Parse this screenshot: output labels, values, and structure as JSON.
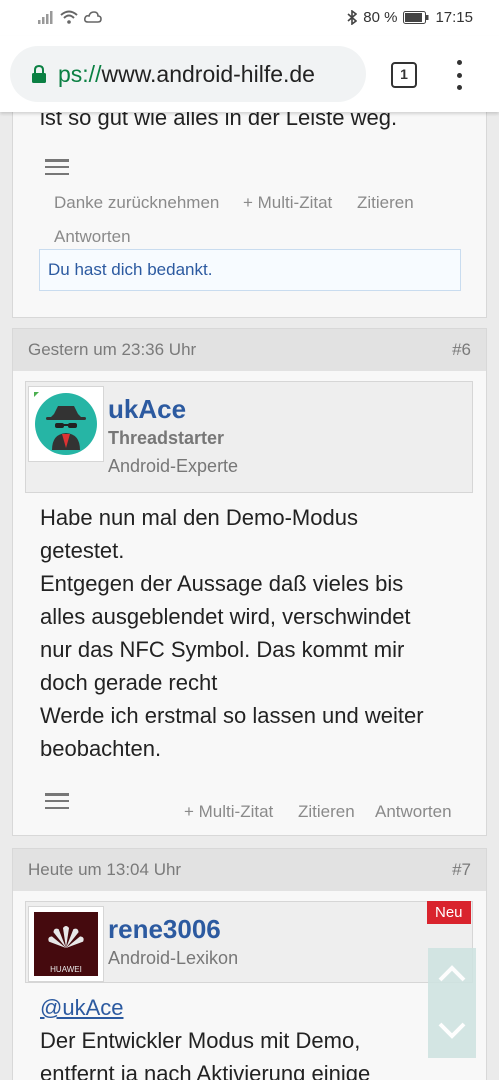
{
  "status_bar": {
    "battery_percent": "80 %",
    "time": "17:15"
  },
  "browser": {
    "url_scheme": "ps://",
    "url_host": "www.android-hilfe.de",
    "tab_count": "1"
  },
  "post5": {
    "partial_text": "ist so gut wie alles in der Leiste weg.",
    "actions": {
      "unlike": "Danke zurücknehmen",
      "multi_quote": "+ Multi-Zitat",
      "quote": "Zitieren",
      "reply": "Antworten"
    },
    "notice": "Du hast dich bedankt."
  },
  "post6": {
    "timestamp": "Gestern um 23:36 Uhr",
    "number": "#6",
    "username": "ukAce",
    "role_primary": "Threadstarter",
    "role_secondary": "Android-Experte",
    "message_lines": [
      "Habe nun mal den Demo-Modus",
      "getestet.",
      "Entgegen der Aussage daß vieles bis",
      "alles ausgeblendet wird, verschwindet",
      "nur das NFC Symbol. Das kommt mir",
      "doch gerade recht",
      "Werde ich erstmal so lassen und weiter",
      "beobachten."
    ],
    "actions": {
      "multi_quote": "+ Multi-Zitat",
      "quote": "Zitieren",
      "reply": "Antworten"
    }
  },
  "post7": {
    "timestamp": "Heute um 13:04 Uhr",
    "number": "#7",
    "badge": "Neu",
    "username": "rene3006",
    "role": "Android-Lexikon",
    "avatar_brand": "HUAWEI",
    "mention": "@ukAce",
    "message_lines": [
      "Der Entwickler Modus mit Demo,",
      "entfernt ja nach Aktivierung einige"
    ]
  },
  "colors": {
    "accent_link": "#2c5aa0",
    "badge_red": "#d9232d",
    "secure_green": "#0b8043"
  }
}
